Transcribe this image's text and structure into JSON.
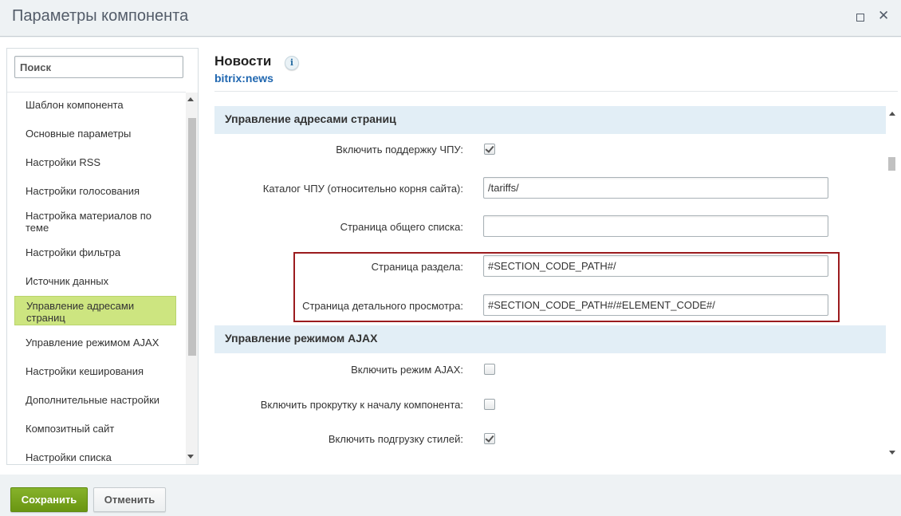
{
  "window": {
    "title": "Параметры компонента",
    "maximize_icon": "maximize-icon",
    "close_icon": "close-icon"
  },
  "sidebar": {
    "search_placeholder": "Поиск",
    "items": [
      {
        "label": "Шаблон компонента"
      },
      {
        "label": "Основные параметры"
      },
      {
        "label": "Настройки RSS"
      },
      {
        "label": "Настройки голосования"
      },
      {
        "label": "Настройка материалов по теме"
      },
      {
        "label": "Настройки фильтра"
      },
      {
        "label": "Источник данных"
      },
      {
        "label": "Управление адресами страниц",
        "active": true
      },
      {
        "label": "Управление режимом AJAX"
      },
      {
        "label": "Настройки кеширования"
      },
      {
        "label": "Дополнительные настройки"
      },
      {
        "label": "Композитный сайт"
      },
      {
        "label": "Настройки списка"
      }
    ]
  },
  "component": {
    "name": "Новости",
    "code": "bitrix:news",
    "info_icon": "info-icon"
  },
  "sections": [
    {
      "title": "Управление адресами страниц",
      "fields": [
        {
          "label": "Включить поддержку ЧПУ:",
          "type": "checkbox",
          "checked": true
        },
        {
          "label": "Каталог ЧПУ (относительно корня сайта):",
          "type": "text",
          "value": "/tariffs/"
        },
        {
          "label": "Страница общего списка:",
          "type": "text",
          "value": ""
        },
        {
          "label": "Страница раздела:",
          "type": "text",
          "value": "#SECTION_CODE_PATH#/"
        },
        {
          "label": "Страница детального просмотра:",
          "type": "text",
          "value": "#SECTION_CODE_PATH#/#ELEMENT_CODE#/"
        }
      ]
    },
    {
      "title": "Управление режимом AJAX",
      "fields": [
        {
          "label": "Включить режим AJAX:",
          "type": "checkbox",
          "checked": false
        },
        {
          "label": "Включить прокрутку к началу компонента:",
          "type": "checkbox",
          "checked": false
        },
        {
          "label": "Включить подгрузку стилей:",
          "type": "checkbox",
          "checked": true
        }
      ]
    }
  ],
  "footer": {
    "save_label": "Сохранить",
    "cancel_label": "Отменить"
  },
  "colors": {
    "save_button": "#76a31c",
    "active_nav": "#cde580",
    "highlight_border": "#9b1b1e",
    "section_header_bg": "#e2eef6"
  }
}
